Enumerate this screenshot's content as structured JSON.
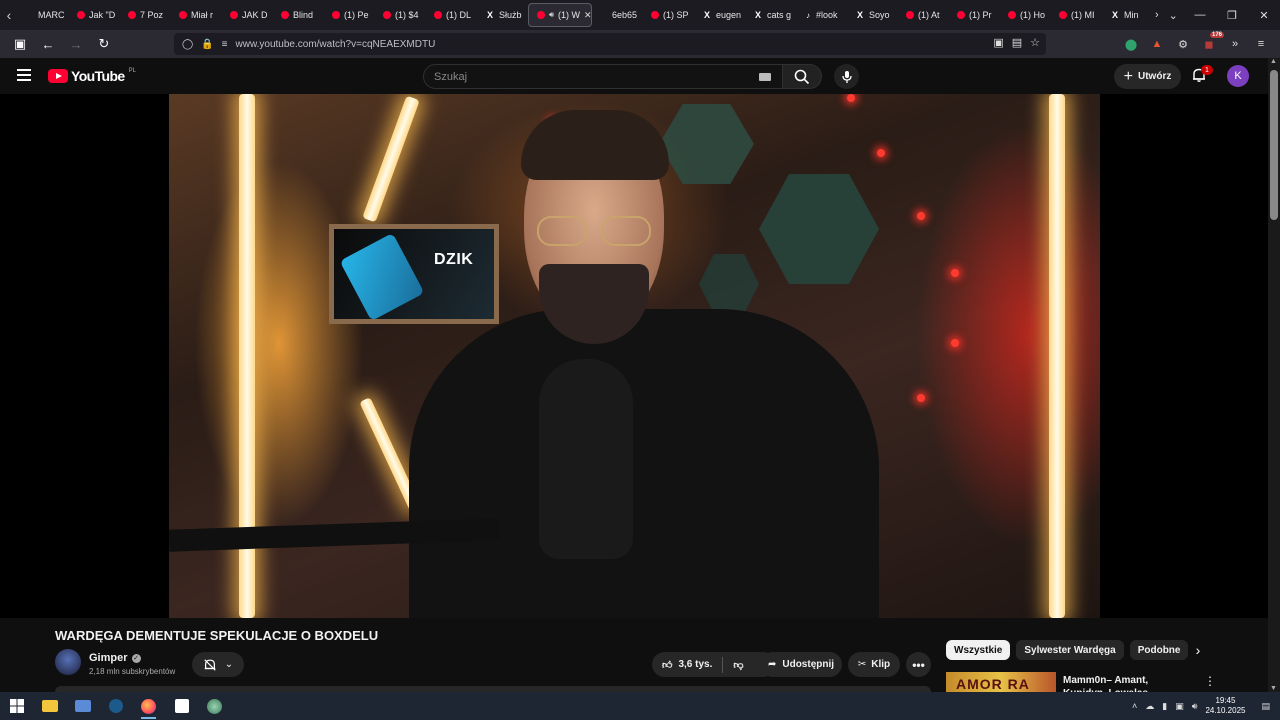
{
  "browser": {
    "tabs": [
      {
        "label": "MARC",
        "favicon": "generic"
      },
      {
        "label": "Jak \"D",
        "favicon": "youtube"
      },
      {
        "label": "7 Poz",
        "favicon": "youtube"
      },
      {
        "label": "Miał r",
        "favicon": "youtube"
      },
      {
        "label": "JAK D",
        "favicon": "youtube"
      },
      {
        "label": "Blind",
        "favicon": "youtube"
      },
      {
        "label": "(1) Pe",
        "favicon": "youtube"
      },
      {
        "label": "(1) $4",
        "favicon": "youtube"
      },
      {
        "label": "(1) DL",
        "favicon": "youtube"
      },
      {
        "label": "Służb",
        "favicon": "x"
      },
      {
        "label": "(1) W",
        "favicon": "youtube",
        "active": true,
        "audio": true
      },
      {
        "label": "6eb65",
        "favicon": "generic"
      },
      {
        "label": "(1) SP",
        "favicon": "youtube"
      },
      {
        "label": "eugen",
        "favicon": "x"
      },
      {
        "label": "cats g",
        "favicon": "x"
      },
      {
        "label": "#look",
        "favicon": "tiktok"
      },
      {
        "label": "Soyo",
        "favicon": "x"
      },
      {
        "label": "(1) At",
        "favicon": "youtube"
      },
      {
        "label": "(1) Pr",
        "favicon": "youtube"
      },
      {
        "label": "(1) Ho",
        "favicon": "youtube"
      },
      {
        "label": "(1) MI",
        "favicon": "youtube"
      },
      {
        "label": "Min",
        "favicon": "x"
      }
    ],
    "url": "www.youtube.com/watch?v=cqNEAEXMDTU",
    "extension_badge": "176"
  },
  "youtube": {
    "logo_text": "YouTube",
    "logo_country": "PL",
    "search_placeholder": "Szukaj",
    "create_label": "Utwórz",
    "notification_count": "1",
    "avatar_letter": "K"
  },
  "video": {
    "title": "WARDĘGA DEMENTUJE SPEKULACJE O BOXDELU",
    "poster_brand": "DZIK",
    "channel": {
      "name": "Gimper",
      "subscribers": "2,18 mln subskrybentów"
    },
    "likes": "3,6 tys.",
    "share_label": "Udostępnij",
    "clip_label": "Klip"
  },
  "sidebar": {
    "chips": [
      "Wszystkie",
      "Sylwester Wardęga",
      "Podobne"
    ],
    "recommendation": {
      "thumb_text": "AMOR RA",
      "title": "Mamm0n– Amant, Kupidyn, Lowelas"
    }
  },
  "taskbar": {
    "time": "19:45",
    "date": "24.10.2025"
  },
  "colors": {
    "youtube_red": "#ff0033",
    "background": "#0f0f0f",
    "chip_active": "#f1f1f1",
    "avatar": "#7b3fbf"
  }
}
